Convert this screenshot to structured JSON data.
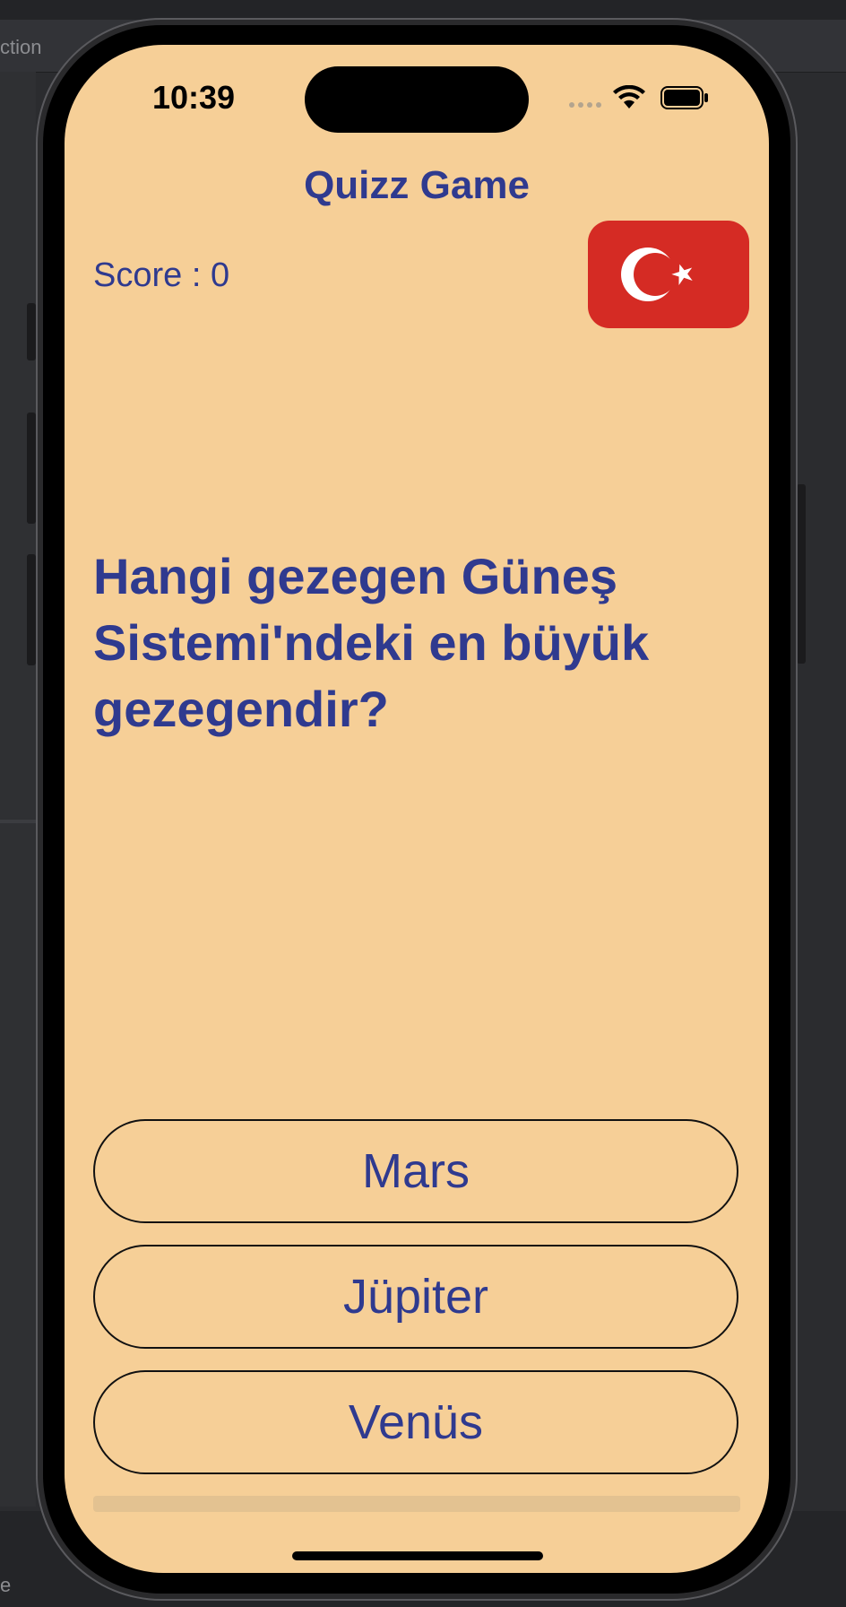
{
  "host": {
    "toolbar_label": "ction",
    "bottom_label": "e"
  },
  "status_bar": {
    "time": "10:39"
  },
  "app": {
    "title": "Quizz Game",
    "score_text": "Score : 0",
    "language_flag": {
      "icon": "turkey-flag-icon",
      "color": "#d52b24"
    },
    "question": "Hangi gezegen Güneş Sistemi'ndeki en büyük gezegendir?",
    "answers": [
      {
        "label": "Mars"
      },
      {
        "label": "Jüpiter"
      },
      {
        "label": "Venüs"
      }
    ],
    "progress": 0
  },
  "colors": {
    "background": "#f6cf97",
    "text": "#2f3a8f",
    "flag": "#d52b24"
  }
}
